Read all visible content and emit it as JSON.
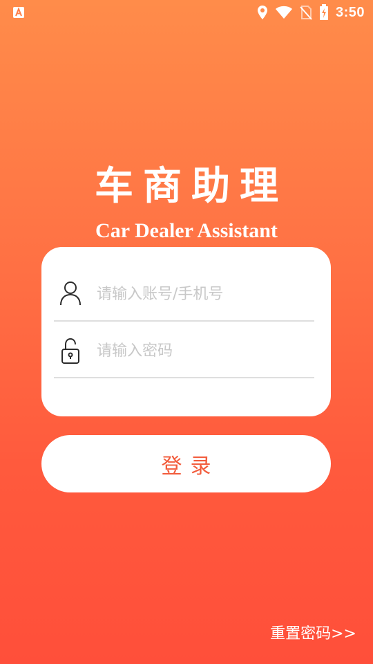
{
  "status_bar": {
    "time": "3:50",
    "app_icon": "android-a-icon",
    "icons": [
      "location-icon",
      "wifi-icon",
      "no-sim-icon",
      "battery-charging-icon"
    ]
  },
  "header": {
    "title_cn": "车商助理",
    "title_en": "Car Dealer Assistant"
  },
  "login_form": {
    "account": {
      "icon": "user-icon",
      "placeholder": "请输入账号/手机号",
      "value": ""
    },
    "password": {
      "icon": "lock-icon",
      "placeholder": "请输入密码",
      "value": ""
    },
    "login_label": "登录"
  },
  "footer": {
    "reset_label": "重置密码>>"
  },
  "colors": {
    "gradient_top": "#ff8c4a",
    "gradient_bottom": "#ff4f3a",
    "accent_text": "#f25c3c",
    "placeholder": "#c8c8c8"
  }
}
